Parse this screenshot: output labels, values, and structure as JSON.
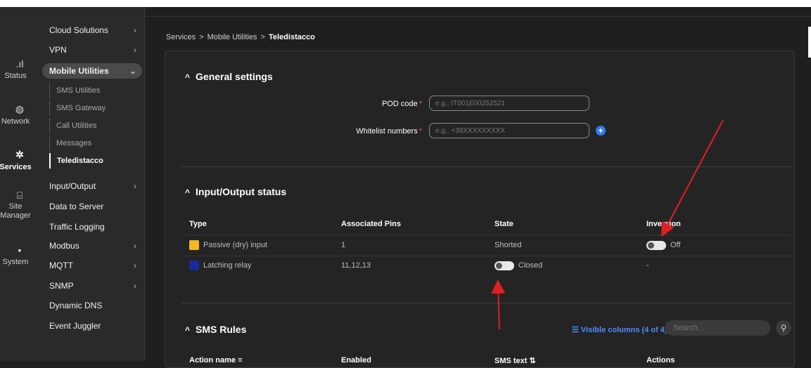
{
  "rail": [
    {
      "label": "Status",
      "icon": "signal-icon",
      "glyph": ".ıl"
    },
    {
      "label": "Network",
      "icon": "globe-icon",
      "glyph": "◍"
    },
    {
      "label": "Services",
      "icon": "gear-icon",
      "glyph": "✲"
    },
    {
      "label": "Site Manager",
      "icon": "network-device-icon",
      "glyph": "⌸"
    },
    {
      "label": "System",
      "icon": "system-icon",
      "glyph": "▪"
    }
  ],
  "sidebar": {
    "items": [
      {
        "label": "Cloud Solutions",
        "chevron": "›"
      },
      {
        "label": "VPN",
        "chevron": "›"
      },
      {
        "label": "Mobile Utilities",
        "chevron": "⌄"
      },
      {
        "label": "Input/Output",
        "chevron": "›"
      },
      {
        "label": "Data to Server",
        "chevron": ""
      },
      {
        "label": "Traffic Logging",
        "chevron": ""
      },
      {
        "label": "Modbus",
        "chevron": "›"
      },
      {
        "label": "MQTT",
        "chevron": "›"
      },
      {
        "label": "SNMP",
        "chevron": "›"
      },
      {
        "label": "Dynamic DNS",
        "chevron": ""
      },
      {
        "label": "Event Juggler",
        "chevron": ""
      }
    ],
    "sub_items": [
      "SMS Utilities",
      "SMS Gateway",
      "Call Utilities",
      "Messages",
      "Teledistacco"
    ]
  },
  "breadcrumb": {
    "parts": [
      "Services",
      "Mobile Utilities"
    ],
    "current": "Teledistacco",
    "sep": ">"
  },
  "general": {
    "title": "General settings",
    "caret": "^",
    "pod_label": "POD code",
    "pod_placeholder": "e.g., IT001E00252521",
    "whitelist_label": "Whitelist numbers",
    "whitelist_placeholder": "e.g., +39XXXXXXXXX",
    "required_mark": "*",
    "add_glyph": "+"
  },
  "io": {
    "title": "Input/Output status",
    "caret": "^",
    "headers": [
      "Type",
      "Associated Pins",
      "State",
      "Inversion"
    ],
    "rows": [
      {
        "type": "Passive (dry) input",
        "color": "#f5b820",
        "pins": "1",
        "state": "Shorted",
        "inversion": "Off"
      },
      {
        "type": "Latching relay",
        "color": "#1a2a9a",
        "pins": "11,12,13",
        "state": "Closed",
        "inversion": "-"
      }
    ]
  },
  "sms": {
    "title": "SMS Rules",
    "caret": "^",
    "visible_columns": "Visible columns (4 of 4)",
    "search_placeholder": "Search...",
    "headers": [
      "Action name",
      "Enabled",
      "SMS text",
      "Actions"
    ]
  },
  "colors": {
    "accent": "#2f7bf5",
    "annotation": "#e02020"
  }
}
